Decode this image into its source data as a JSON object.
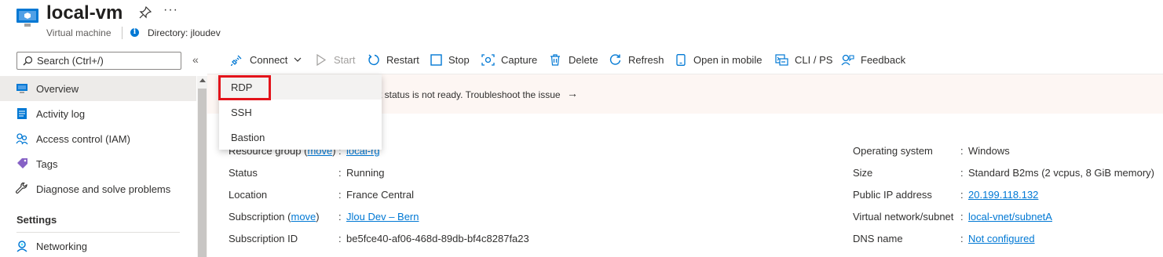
{
  "header": {
    "title": "local-vm",
    "subtitle": "Virtual machine",
    "directory": "Directory: jloudev",
    "more": "···"
  },
  "search": {
    "placeholder": "Search (Ctrl+/)",
    "collapse": "«"
  },
  "sidebar": {
    "items": [
      {
        "label": "Overview",
        "icon": "monitor-icon",
        "active": true
      },
      {
        "label": "Activity log",
        "icon": "activity-log-icon"
      },
      {
        "label": "Access control (IAM)",
        "icon": "people-icon"
      },
      {
        "label": "Tags",
        "icon": "tag-icon"
      },
      {
        "label": "Diagnose and solve problems",
        "icon": "wrench-icon"
      }
    ],
    "section_settings": "Settings",
    "settings_items": [
      {
        "label": "Networking",
        "icon": "networking-icon"
      }
    ]
  },
  "toolbar": {
    "connect": "Connect",
    "start": "Start",
    "restart": "Restart",
    "stop": "Stop",
    "capture": "Capture",
    "delete": "Delete",
    "refresh": "Refresh",
    "open_mobile": "Open in mobile",
    "cli_ps": "CLI / PS",
    "feedback": "Feedback"
  },
  "banner": {
    "text": "t status is not ready. Troubleshoot the issue",
    "arrow": "→"
  },
  "connect_menu": {
    "items": [
      "RDP",
      "SSH",
      "Bastion"
    ]
  },
  "essentials": {
    "left": [
      {
        "label": "Resource group",
        "action": "move",
        "value": "local-rg",
        "link": true
      },
      {
        "label": "Status",
        "value": "Running"
      },
      {
        "label": "Location",
        "value": "France Central"
      },
      {
        "label": "Subscription",
        "action": "move",
        "value": "Jlou Dev – Bern",
        "link": true
      },
      {
        "label": "Subscription ID",
        "value": "be5fce40-af06-468d-89db-bf4c8287fa23"
      }
    ],
    "right": [
      {
        "label": "Operating system",
        "value": "Windows"
      },
      {
        "label": "Size",
        "value": "Standard B2ms (2 vcpus, 8 GiB memory)"
      },
      {
        "label": "Public IP address",
        "value": "20.199.118.132",
        "link": true
      },
      {
        "label": "Virtual network/subnet",
        "value": "local-vnet/subnetA",
        "link": true
      },
      {
        "label": "DNS name",
        "value": "Not configured",
        "link": true
      }
    ]
  },
  "colors": {
    "accent": "#0078d4",
    "highlight": "#e3131a",
    "banner": "#fdf6f3"
  }
}
